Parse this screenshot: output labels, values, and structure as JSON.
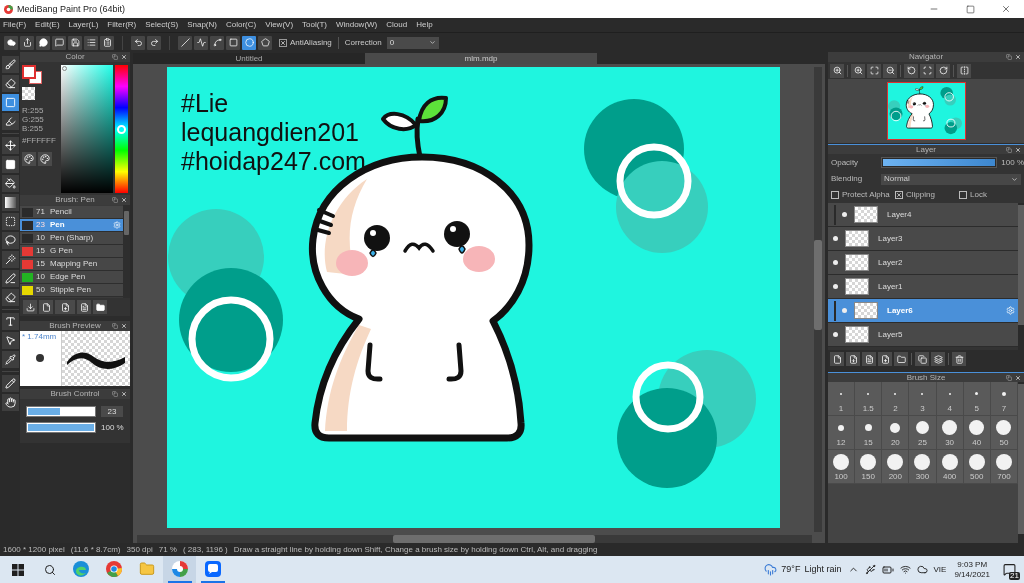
{
  "window": {
    "title": "MediBang Paint Pro (64bit)"
  },
  "menu": [
    "File(F)",
    "Edit(E)",
    "Layer(L)",
    "Filter(R)",
    "Select(S)",
    "Snap(N)",
    "Color(C)",
    "View(V)",
    "Tool(T)",
    "Window(W)",
    "Cloud",
    "Help"
  ],
  "toolbar": {
    "shape_tools": [
      {
        "kind": "line",
        "selected": false
      },
      {
        "kind": "polyline",
        "selected": false
      },
      {
        "kind": "curve",
        "selected": false
      },
      {
        "kind": "rectangle",
        "selected": false
      },
      {
        "kind": "ellipse",
        "selected": true
      },
      {
        "kind": "polygon",
        "selected": false
      }
    ],
    "antialiasing": {
      "label": "AntiAliasing",
      "checked": true
    },
    "correction": {
      "label": "Correction",
      "value": "0"
    }
  },
  "tool_groups": [
    [
      {
        "kind": "brush",
        "selected": false
      },
      {
        "kind": "eraser",
        "selected": false
      },
      {
        "kind": "dot",
        "selected": true
      },
      {
        "kind": "stroke",
        "selected": false
      }
    ],
    [
      {
        "kind": "move",
        "selected": false
      },
      {
        "kind": "fill",
        "selected": false
      },
      {
        "kind": "bucket",
        "selected": false
      },
      {
        "kind": "gradient",
        "selected": false
      },
      {
        "kind": "select-rect",
        "selected": false
      },
      {
        "kind": "lasso",
        "selected": false
      },
      {
        "kind": "wand",
        "selected": false
      },
      {
        "kind": "select-pen",
        "selected": false
      },
      {
        "kind": "select-eraser",
        "selected": false
      }
    ],
    [
      {
        "kind": "text",
        "selected": false
      },
      {
        "kind": "operation",
        "selected": false
      },
      {
        "kind": "eyedropper",
        "selected": false
      }
    ],
    [
      {
        "kind": "divide",
        "selected": false
      },
      {
        "kind": "hand",
        "selected": false
      }
    ]
  ],
  "color_panel": {
    "title": "Color",
    "rgb": [
      "R:255",
      "G:255",
      "B:255"
    ],
    "hex": "#FFFFFF",
    "hue": {
      "level": 0.5
    }
  },
  "brush_panel": {
    "title": "Brush: Pen",
    "brushes": [
      {
        "size": "71",
        "name": "Pencil",
        "color": "#2a2a2a",
        "selected": false
      },
      {
        "size": "23",
        "name": "Pen",
        "color": "#2a2a2a",
        "selected": true
      },
      {
        "size": "10",
        "name": "Pen (Sharp)",
        "color": "#2a2a2a",
        "selected": false
      },
      {
        "size": "15",
        "name": "G Pen",
        "color": "#e53935",
        "selected": false
      },
      {
        "size": "15",
        "name": "Mapping Pen",
        "color": "#e53935",
        "selected": false
      },
      {
        "size": "10",
        "name": "Edge Pen",
        "color": "#22b322",
        "selected": false
      },
      {
        "size": "50",
        "name": "Stipple Pen",
        "color": "#e6d800",
        "selected": false
      }
    ]
  },
  "brush_preview": {
    "title": "Brush Preview",
    "size": "* 1.74mm"
  },
  "brush_control": {
    "title": "Brush Control",
    "size": {
      "level": 0.48,
      "value": "23"
    },
    "opacity": {
      "level": 1,
      "value": "100 %"
    }
  },
  "document_tabs": [
    {
      "label": "Untitled",
      "selected": false
    },
    {
      "label": "mlm.mdp",
      "selected": true
    }
  ],
  "canvas": {
    "texts": [
      "#Lie",
      "lequangdien201",
      "#hoidap247.com"
    ]
  },
  "navigator": {
    "title": "Navigator"
  },
  "layer_panel": {
    "title": "Layer",
    "opacity": {
      "label": "Opacity",
      "level": 1,
      "value": "100 %"
    },
    "blending": {
      "label": "Blending",
      "value": "Normal"
    },
    "options": [
      {
        "label": "Protect Alpha",
        "checked": false
      },
      {
        "label": "Clipping",
        "checked": true
      },
      {
        "label": "Lock",
        "checked": false
      }
    ],
    "layers": [
      {
        "name": "Layer4",
        "visible": true,
        "clipped": true,
        "selected": false
      },
      {
        "name": "Layer3",
        "visible": true,
        "clipped": false,
        "selected": false
      },
      {
        "name": "Layer2",
        "visible": true,
        "clipped": false,
        "selected": false
      },
      {
        "name": "Layer1",
        "visible": true,
        "clipped": false,
        "selected": false
      },
      {
        "name": "Layer6",
        "visible": true,
        "clipped": true,
        "selected": true
      },
      {
        "name": "Layer5",
        "visible": true,
        "clipped": false,
        "selected": false
      }
    ]
  },
  "brush_size_panel": {
    "title": "Brush Size",
    "sizes": [
      "1",
      "1.5",
      "2",
      "3",
      "4",
      "5",
      "7",
      "12",
      "15",
      "20",
      "25",
      "30",
      "40",
      "50",
      "100",
      "150",
      "200",
      "300",
      "400",
      "500",
      "700"
    ]
  },
  "status_bar": {
    "image_size": "1600 * 1200 pixel",
    "print_size": "(11.6 * 8.7cm)",
    "resolution": "350 dpi",
    "zoom": "71 %",
    "cursor": "( 283, 1196 )",
    "hint": "Draw a straight line by holding down Shift, Change a brush size by holding down Ctrl, Alt, and dragging"
  },
  "taskbar": {
    "apps": [
      {
        "kind": "edge",
        "running": false,
        "selected": false
      },
      {
        "kind": "chrome",
        "running": false,
        "selected": false
      },
      {
        "kind": "folder",
        "running": false,
        "selected": false
      },
      {
        "kind": "paint",
        "running": true,
        "selected": true
      },
      {
        "kind": "chat",
        "running": true,
        "selected": false
      }
    ],
    "weather": {
      "temperature": "79°F",
      "condition": "Light rain"
    },
    "language": "VIE",
    "time": "9:03 PM",
    "date": "9/14/2021",
    "notification_count": "21"
  }
}
